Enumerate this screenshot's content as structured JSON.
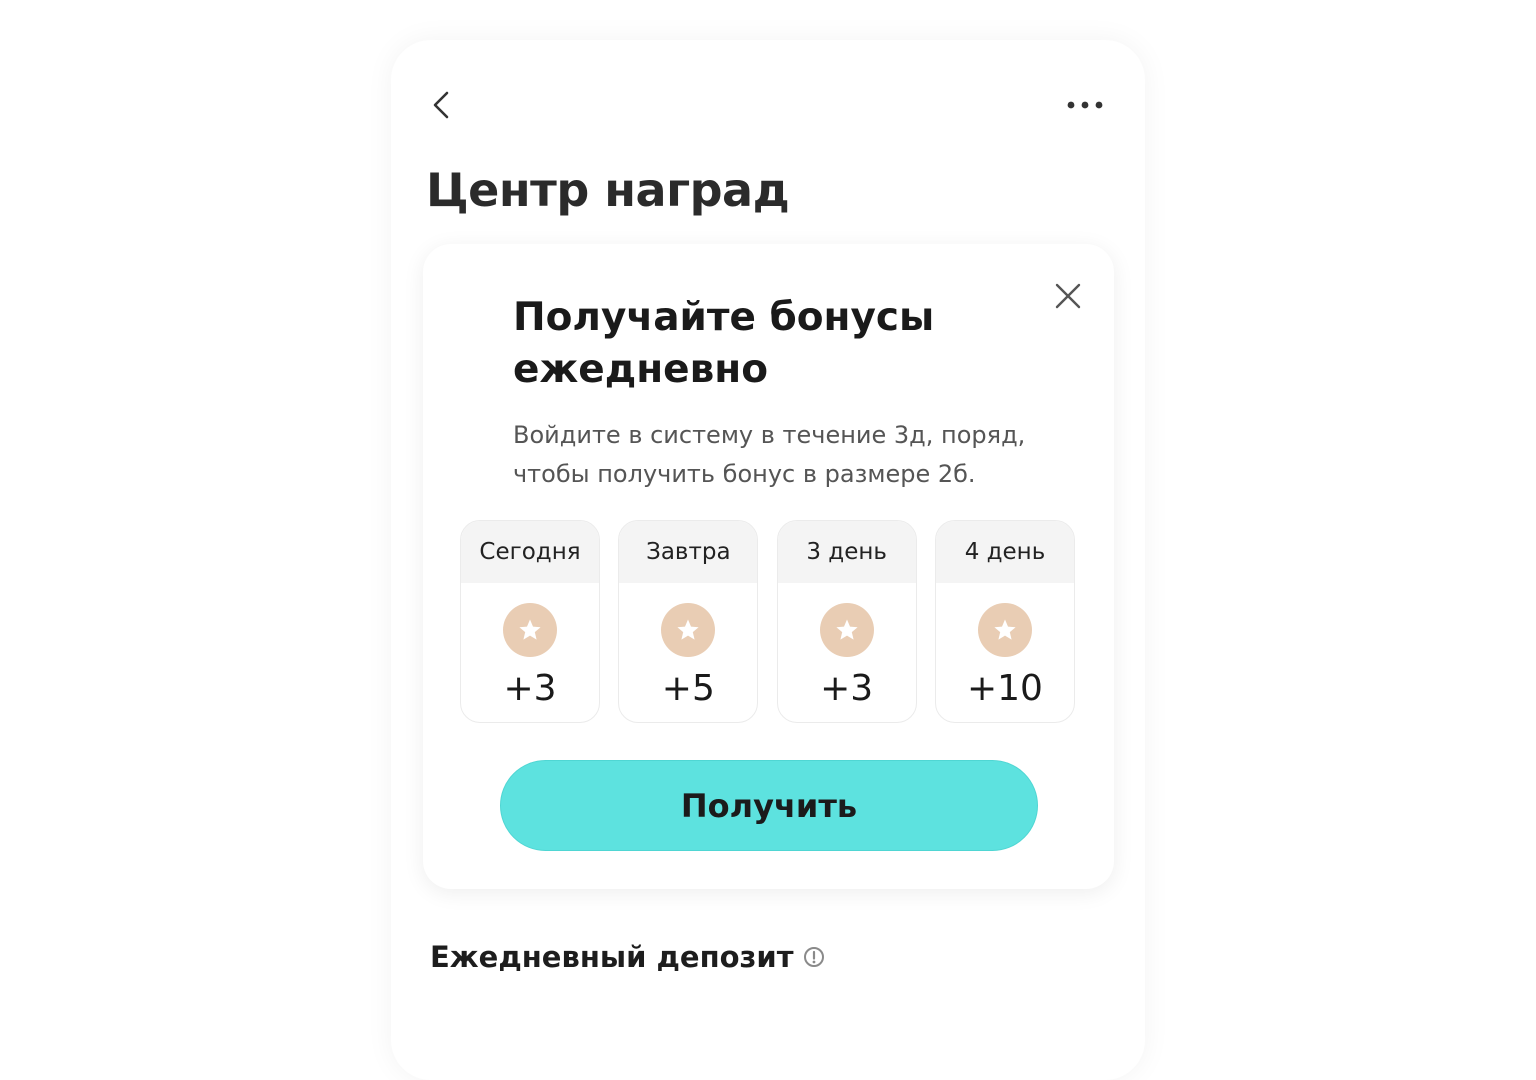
{
  "header": {
    "back_icon": "chevron-left-icon",
    "more_icon": "more-dots-icon",
    "title": "Центр наград"
  },
  "bonus_card": {
    "close_icon": "close-icon",
    "title": "Получайте бонусы ежедневно",
    "description": "Войдите в систему в течение 3д, поряд, чтобы получить бонус в размере 2б.",
    "coin_color": "#e9cdb4",
    "days": [
      {
        "label": "Сегодня",
        "reward": "+3",
        "icon": "star-coin-icon"
      },
      {
        "label": "Завтра",
        "reward": "+5",
        "icon": "star-coin-icon"
      },
      {
        "label": "3 день",
        "reward": "+3",
        "icon": "star-coin-icon"
      },
      {
        "label": "4 день",
        "reward": "+10",
        "icon": "star-coin-icon"
      }
    ],
    "claim_label": "Получить",
    "claim_color": "#5de2df"
  },
  "daily_deposit": {
    "title": "Ежедневный депозит",
    "info_icon": "info-icon"
  }
}
